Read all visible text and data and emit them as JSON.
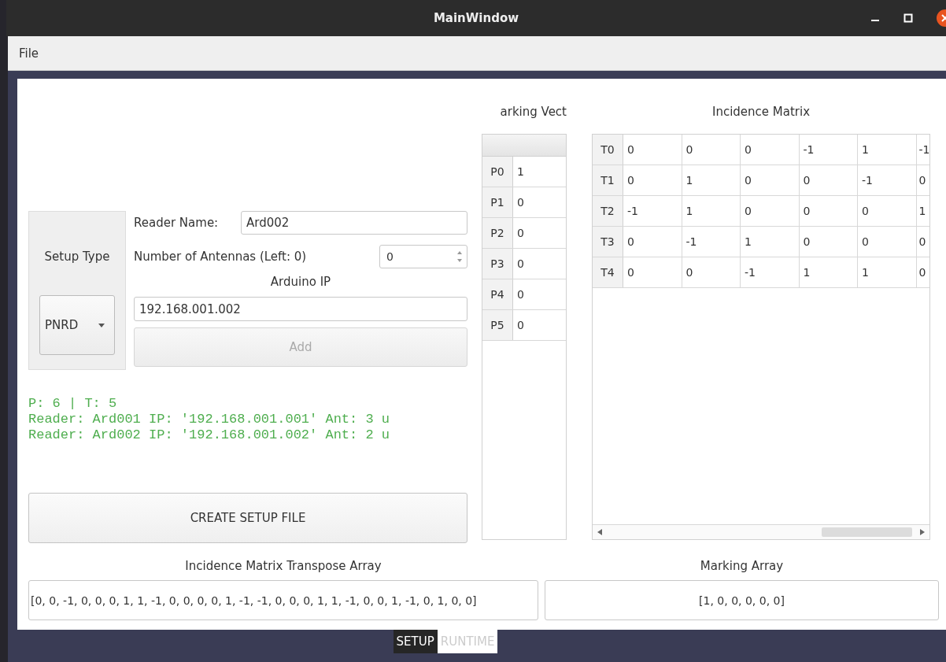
{
  "window": {
    "title": "MainWindow"
  },
  "menu_bar": {
    "items": [
      {
        "label": "File"
      }
    ]
  },
  "setup": {
    "group_label": "Setup Type",
    "setup_type": "PNRD",
    "reader_name_label": "Reader Name:",
    "reader_name": "Ard002",
    "antennas_label": "Number of Antennas  (Left: 0)",
    "antennas": "0",
    "arduino_ip_label": "Arduino IP",
    "arduino_ip": "192.168.001.002",
    "add_button": {
      "label": "Add",
      "disabled": true
    }
  },
  "log": [
    "P: 6 | T: 5",
    "Reader: Ard001 IP: '192.168.001.001' Ant: 3 u",
    "Reader: Ard002 IP: '192.168.001.002' Ant: 2 u"
  ],
  "create_button": "CREATE SETUP FILE",
  "marking_vector": {
    "title": "arking Vect",
    "rows": [
      {
        "label": "P0",
        "value": "1"
      },
      {
        "label": "P1",
        "value": "0"
      },
      {
        "label": "P2",
        "value": "0"
      },
      {
        "label": "P3",
        "value": "0"
      },
      {
        "label": "P4",
        "value": "0"
      },
      {
        "label": "P5",
        "value": "0"
      }
    ]
  },
  "incidence_matrix": {
    "title": "Incidence Matrix",
    "rows": [
      {
        "label": "T0",
        "values": [
          "0",
          "0",
          "0",
          "-1",
          "1",
          "-1"
        ]
      },
      {
        "label": "T1",
        "values": [
          "0",
          "1",
          "0",
          "0",
          "-1",
          "0"
        ]
      },
      {
        "label": "T2",
        "values": [
          "-1",
          "1",
          "0",
          "0",
          "0",
          "1"
        ]
      },
      {
        "label": "T3",
        "values": [
          "0",
          "-1",
          "1",
          "0",
          "0",
          "0"
        ]
      },
      {
        "label": "T4",
        "values": [
          "0",
          "0",
          "-1",
          "1",
          "1",
          "0"
        ]
      }
    ]
  },
  "transpose": {
    "label": "Incidence Matrix Transpose Array",
    "value": "[0, 0, -1, 0, 0, 0, 1, 1, -1, 0, 0, 0, 0, 1, -1, -1, 0, 0, 0, 1, 1, -1, 0, 0, 1, -1, 0, 1, 0, 0]"
  },
  "marking_array": {
    "label": "Marking Array",
    "value": "[1, 0, 0, 0, 0, 0]"
  },
  "tabs": [
    {
      "label": "SETUP",
      "selected": true
    },
    {
      "label": "RUNTIME",
      "selected": false
    }
  ]
}
